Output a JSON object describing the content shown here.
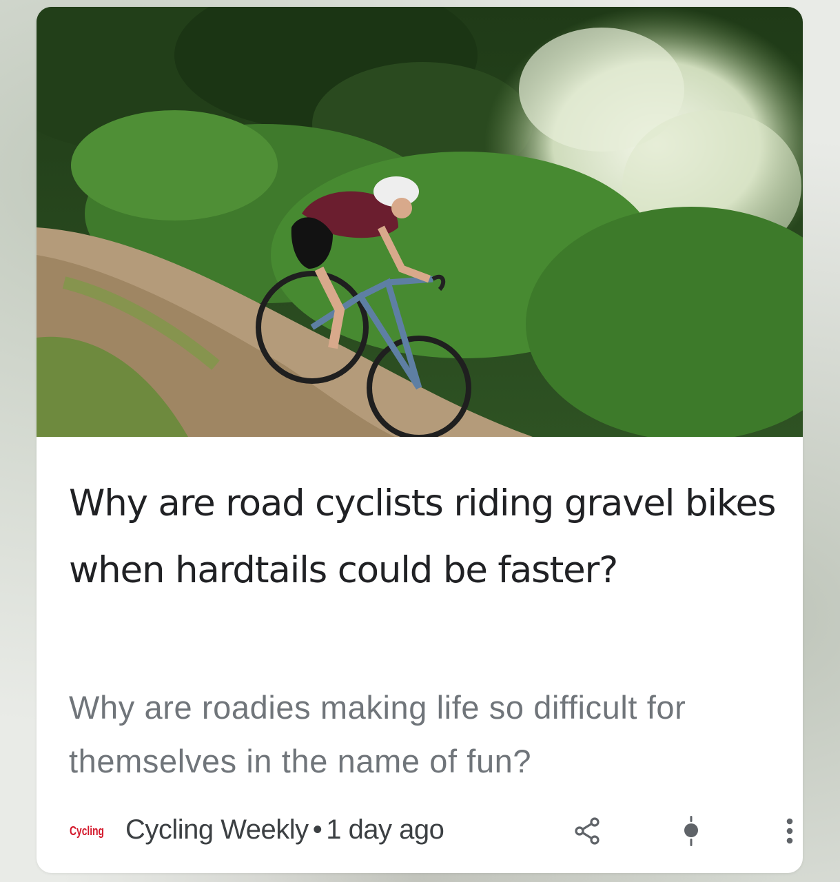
{
  "article": {
    "title": "Why are road cyclists riding gravel bikes when hardtails could be faster?",
    "snippet": "Why are roadies making life so difficult for themselves in the name of fun?",
    "source": {
      "logo_text": "Cycling",
      "name": "Cycling Weekly",
      "separator": "•",
      "age": "1 day ago"
    }
  },
  "actions": {
    "share_icon": "share-icon",
    "pin_icon": "pin-icon",
    "more_icon": "more-vert-icon"
  },
  "colors": {
    "title": "#202124",
    "snippet": "#70757a",
    "source": "#3c4043",
    "logo_red": "#d3172a"
  }
}
